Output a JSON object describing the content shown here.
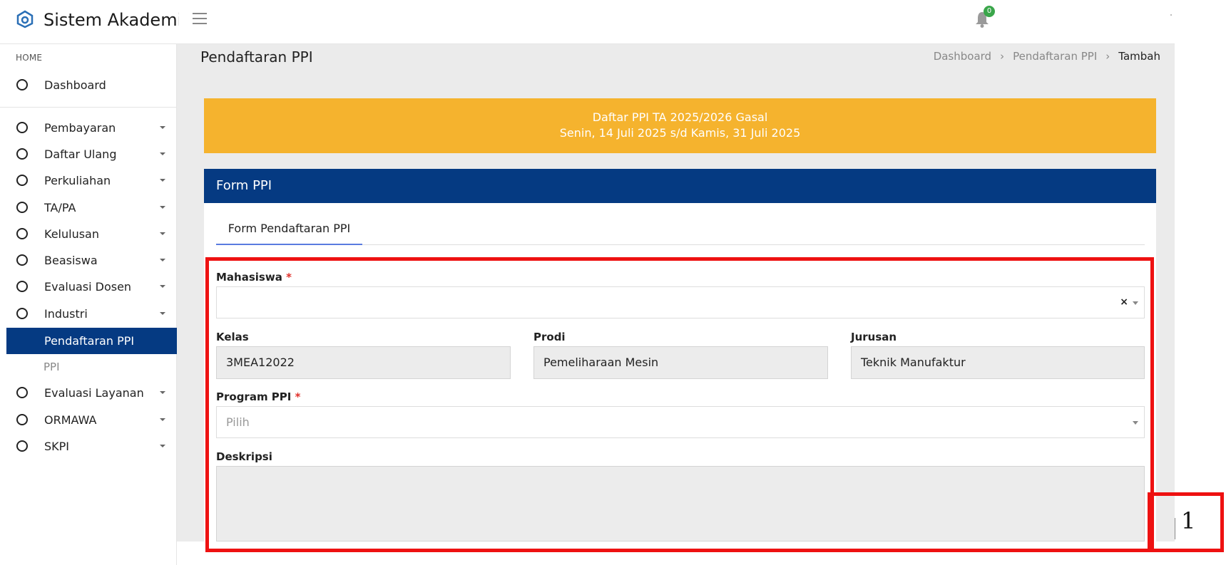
{
  "app": {
    "title": "Sistem Akademik",
    "notification_count": "0",
    "colors": {
      "primary": "#053a82",
      "alert": "#f5b32e",
      "badge": "#3aa64a",
      "annotation": "#ee1111"
    }
  },
  "sidebar": {
    "section_label": "HOME",
    "dashboard": "Dashboard",
    "items": [
      {
        "label": "Pembayaran"
      },
      {
        "label": "Daftar Ulang"
      },
      {
        "label": "Perkuliahan"
      },
      {
        "label": "TA/PA"
      },
      {
        "label": "Kelulusan"
      },
      {
        "label": "Beasiswa"
      },
      {
        "label": "Evaluasi Dosen"
      },
      {
        "label": "Industri"
      }
    ],
    "active_item": "Pendaftaran PPI",
    "sub_item": "PPI",
    "items_after": [
      {
        "label": "Evaluasi Layanan"
      },
      {
        "label": "ORMAWA"
      },
      {
        "label": "SKPI"
      }
    ]
  },
  "page": {
    "title": "Pendaftaran PPI",
    "breadcrumb": [
      "Dashboard",
      "Pendaftaran PPI",
      "Tambah"
    ]
  },
  "alert": {
    "line1": "Daftar PPI TA 2025/2026 Gasal",
    "line2": "Senin, 14 Juli 2025 s/d Kamis, 31 Juli 2025"
  },
  "form": {
    "card_title": "Form PPI",
    "tab_label": "Form Pendaftaran PPI",
    "mahasiswa_label": "Mahasiswa",
    "mahasiswa_value": "",
    "kelas_label": "Kelas",
    "kelas_value": "3MEA12022",
    "prodi_label": "Prodi",
    "prodi_value": "Pemeliharaan Mesin",
    "jurusan_label": "Jurusan",
    "jurusan_value": "Teknik Manufaktur",
    "program_label": "Program PPI",
    "program_placeholder": "Pilih",
    "deskripsi_label": "Deskripsi",
    "deskripsi_value": "",
    "required_mark": "*",
    "clear_glyph": "×"
  },
  "annotation": {
    "label": "1"
  }
}
